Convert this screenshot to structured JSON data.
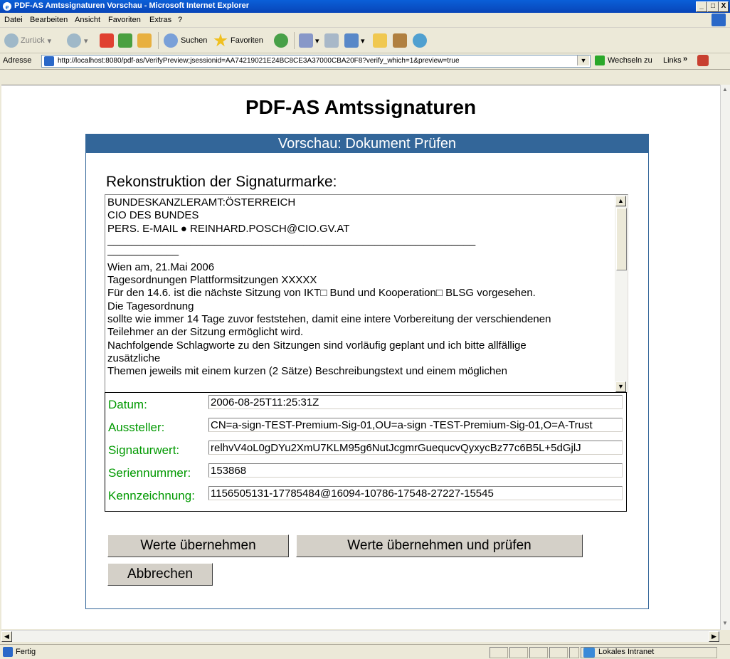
{
  "window": {
    "title": "PDF-AS Amtssignaturen Vorschau - Microsoft Internet Explorer",
    "controls": [
      "_",
      "□",
      "X"
    ]
  },
  "menu": [
    "Datei",
    "Bearbeiten",
    "Ansicht",
    "Favoriten",
    "Extras",
    "?"
  ],
  "toolbar": {
    "back_label": "Zurück",
    "search_label": "Suchen",
    "favorites_label": "Favoriten"
  },
  "address": {
    "label": "Adresse",
    "url": "http://localhost:8080/pdf-as/VerifyPreview;jsessionid=AA74219021E24BC8CE3A37000CBA20F8?verify_which=1&preview=true",
    "go_label": "Wechseln zu",
    "links_label": "Links"
  },
  "page": {
    "title": "PDF-AS Amtssignaturen",
    "panel_header": "Vorschau: Dokument Prüfen",
    "reconstruction_label": "Rekonstruktion der Signaturmarke:",
    "textarea_lines": [
      "BUNDESKANZLERAMT:ÖSTERREICH",
      "CIO DES BUNDES",
      "PERS. E-MAIL ● REINHARD.POSCH@CIO.GV.AT",
      "______________________________________________________________",
      "____________",
      "Wien am, 21.Mai 2006",
      "Tagesordnungen Plattformsitzungen XXXXX",
      "Für den 14.6. ist die nächste Sitzung von IKT□ Bund und Kooperation□ BLSG vorgesehen.",
      "Die Tagesordnung",
      "sollte wie immer 14 Tage zuvor feststehen, damit eine intere Vorbereitung der verschiendenen",
      "Teilehmer an der Sitzung ermöglicht wird.",
      "Nachfolgende Schlagworte zu den Sitzungen sind vorläufig geplant und ich bitte allfällige",
      "zusätzliche",
      "Themen jeweils mit einem kurzen (2 Sätze) Beschreibungstext und einem möglichen"
    ],
    "fields": [
      {
        "label": "Datum:",
        "value": "2006-08-25T11:25:31Z"
      },
      {
        "label": "Aussteller:",
        "value": "CN=a-sign-TEST-Premium-Sig-01,OU=a-sign -TEST-Premium-Sig-01,O=A-Trust"
      },
      {
        "label": "Signaturwert:",
        "value": "relhvV4oL0gDYu2XmU7KLM95g6NutJcgmrGuequcvQyxycBz77c6B5L+5dGjlJ"
      },
      {
        "label": "Seriennummer:",
        "value": "153868"
      },
      {
        "label": "Kennzeichnung:",
        "value": "1156505131-17785484@16094-10786-17548-27227-15545"
      }
    ],
    "buttons": {
      "accept": "Werte übernehmen",
      "accept_verify": "Werte übernehmen und prüfen",
      "cancel": "Abbrechen"
    }
  },
  "status": {
    "left": "Fertig",
    "zone": "Lokales Intranet"
  }
}
